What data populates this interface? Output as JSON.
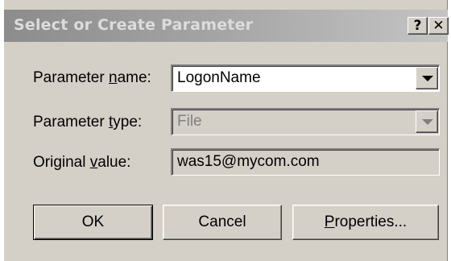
{
  "window": {
    "title": "Select or Create Parameter",
    "help_label": "?",
    "close_label": "✕"
  },
  "fields": {
    "name": {
      "label_pre": "Parameter ",
      "label_key": "n",
      "label_post": "ame:",
      "value": "LogonName"
    },
    "type": {
      "label_pre": "Parameter ",
      "label_key": "t",
      "label_post": "ype:",
      "value": "File"
    },
    "original": {
      "label_pre": "Original ",
      "label_key": "v",
      "label_post": "alue:",
      "value": "was15@mycom.com"
    }
  },
  "buttons": {
    "ok": "OK",
    "cancel": "Cancel",
    "properties_key": "P",
    "properties_rest": "roperties..."
  }
}
